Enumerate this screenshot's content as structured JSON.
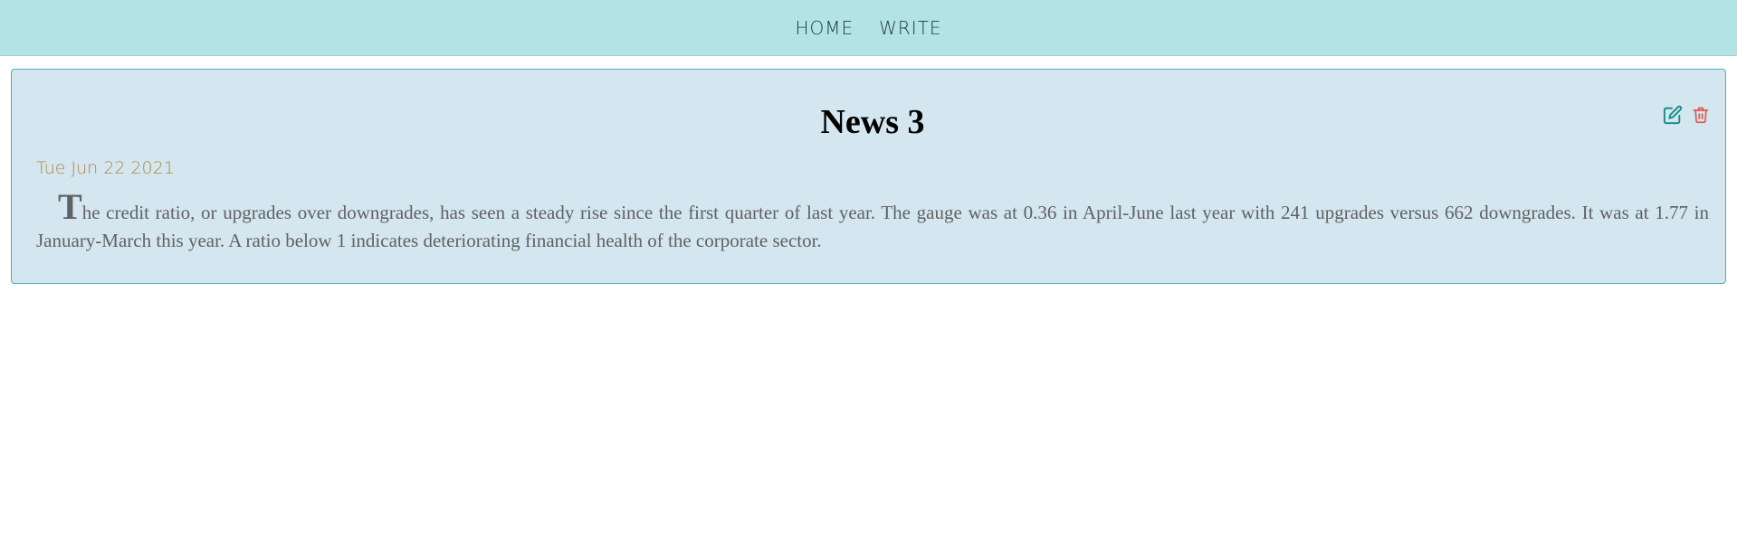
{
  "nav": {
    "items": [
      {
        "label": "HOME"
      },
      {
        "label": "WRITE"
      }
    ]
  },
  "post": {
    "title": "News 3",
    "date": "Tue Jun 22 2021",
    "body_first_letter": "T",
    "body_rest": "he credit ratio, or upgrades over downgrades, has seen a steady rise since the first quarter of last year. The gauge was at 0.36 in April-June last year with 241 upgrades versus 662 downgrades. It was at 1.77 in January-March this year. A ratio below 1 indicates deteriorating financial health of the corporate sector.",
    "actions": {
      "edit_icon": "edit-icon",
      "delete_icon": "trash-icon"
    }
  },
  "colors": {
    "topbar": "#b2e4e6",
    "post_bg": "#d4e6f0",
    "post_border": "#4eb0b3",
    "date": "#b08a4a",
    "edit": "#0e8a86",
    "delete": "#e5534b"
  }
}
